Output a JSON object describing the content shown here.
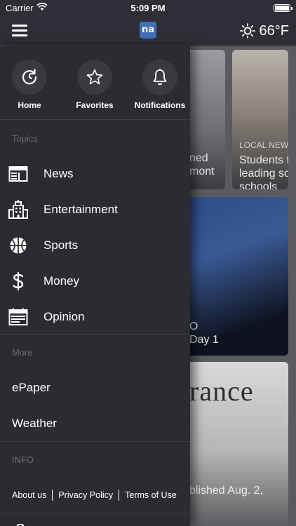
{
  "status_bar": {
    "carrier": "Carrier",
    "time": "5:09 PM"
  },
  "nav": {
    "logo_text": "na",
    "weather_temp": "66°F",
    "weather_icon": "sun-icon"
  },
  "quick_actions": [
    {
      "label": "Home",
      "icon": "refresh-home-icon"
    },
    {
      "label": "Favorites",
      "icon": "star-icon"
    },
    {
      "label": "Notifications",
      "icon": "bell-icon"
    }
  ],
  "topics": {
    "label": "Topics",
    "items": [
      {
        "label": "News",
        "icon": "newspaper-icon"
      },
      {
        "label": "Entertainment",
        "icon": "building-icon"
      },
      {
        "label": "Sports",
        "icon": "basketball-icon"
      },
      {
        "label": "Money",
        "icon": "dollar-icon"
      },
      {
        "label": "Opinion",
        "icon": "calendar-page-icon"
      }
    ]
  },
  "more": {
    "label": "More",
    "items": [
      "ePaper",
      "Weather"
    ]
  },
  "info": {
    "label": "INFO",
    "links": [
      "About us",
      "Privacy Policy",
      "Terms of Use"
    ]
  },
  "feed": {
    "card1_caption": "ned\nmont",
    "card2_tag": "LOCAL NEWS",
    "card2_caption": "Students t\nleading so\nschools",
    "card3_caption": "O\nDay 1",
    "card4_word": "rance",
    "card4_caption": "blished Aug. 2,"
  },
  "colors": {
    "drawer_bg": "#2b2c31",
    "bar_bg": "#2e2f36",
    "logo_bg": "#3f6fb6"
  }
}
